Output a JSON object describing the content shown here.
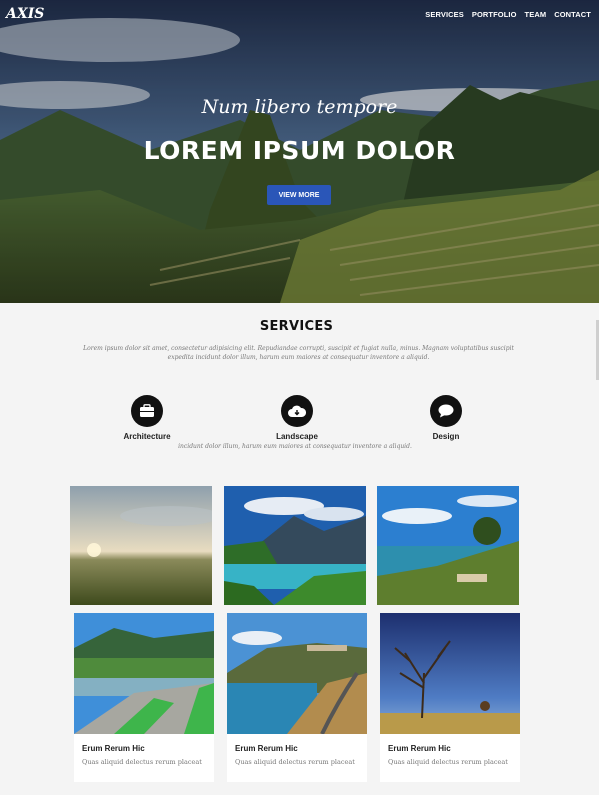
{
  "header": {
    "logo": "AXIS",
    "nav": [
      "SERVICES",
      "PORTFOLIO",
      "TEAM",
      "CONTACT"
    ]
  },
  "hero": {
    "subtitle": "Num libero tempore",
    "title": "LOREM IPSUM DOLOR",
    "button": "VIEW MORE"
  },
  "services": {
    "title": "SERVICES",
    "description": "Lorem ipsum dolor sit amet, consectetur adipisicing elit. Repudiandae corrupti, suscipit et fugiat nulla, minus. Magnam voluptatibus suscipit expedita incidunt dolor illum, harum eum maiores at consequatur inventore a aliquid.",
    "items": [
      {
        "label": "Architecture",
        "icon": "briefcase-icon"
      },
      {
        "label": "Landscape",
        "icon": "cloud-download-icon"
      },
      {
        "label": "Design",
        "icon": "speech-bubble-icon"
      }
    ],
    "note": "incidunt dolor illum, harum eum maiores at consequatur inventore a aliquid."
  },
  "portfolio": {
    "cards": [
      {
        "title": "Erum Rerum Hic",
        "subtitle": "Quas aliquid delectus rerum placeat"
      },
      {
        "title": "Erum Rerum Hic",
        "subtitle": "Quas aliquid delectus rerum placeat"
      },
      {
        "title": "Erum Rerum Hic",
        "subtitle": "Quas aliquid delectus rerum placeat"
      }
    ]
  },
  "colors": {
    "accent": "#2a56b8",
    "page_bg": "#f4f4f4",
    "icon_circle": "#111111"
  }
}
